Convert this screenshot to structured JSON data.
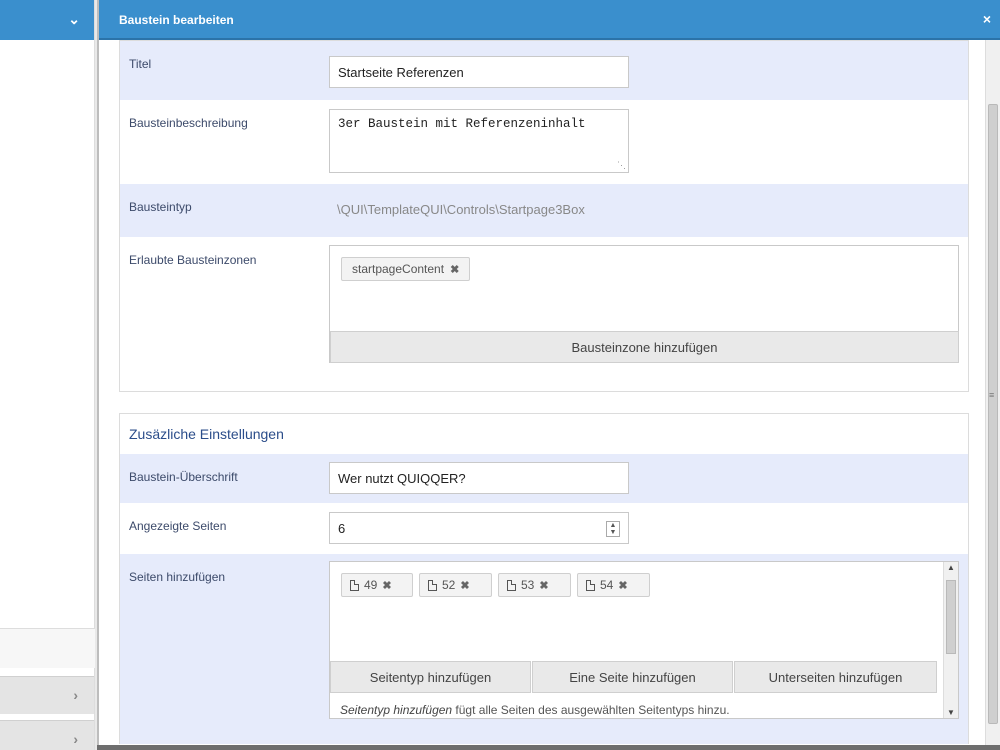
{
  "dialog": {
    "title": "Baustein bearbeiten",
    "close_icon": "×"
  },
  "form": {
    "titel": {
      "label": "Titel",
      "value": "Startseite Referenzen"
    },
    "beschreibung": {
      "label": "Bausteinbeschreibung",
      "value": "3er Baustein mit Referenzeninhalt"
    },
    "typ": {
      "label": "Bausteintyp",
      "value": "\\QUI\\TemplateQUI\\Controls\\Startpage3Box"
    },
    "zonen": {
      "label": "Erlaubte Bausteinzonen",
      "tags": [
        "startpageContent"
      ],
      "add_button": "Bausteinzone hinzufügen"
    }
  },
  "extra": {
    "title": "Zusäzliche Einstellungen",
    "ueberschrift": {
      "label": "Baustein-Überschrift",
      "value": "Wer nutzt QUIQQER?"
    },
    "seiten_anzahl": {
      "label": "Angezeigte Seiten",
      "value": "6"
    },
    "seiten": {
      "label": "Seiten hinzufügen",
      "pages": [
        "49",
        "52",
        "53",
        "54"
      ],
      "buttons": [
        "Seitentyp hinzufügen",
        "Eine Seite hinzufügen",
        "Unterseiten hinzufügen"
      ],
      "hint_em": "Seitentyp hinzufügen",
      "hint_rest": " fügt alle Seiten des ausgewählten Seitentyps hinzu."
    }
  }
}
